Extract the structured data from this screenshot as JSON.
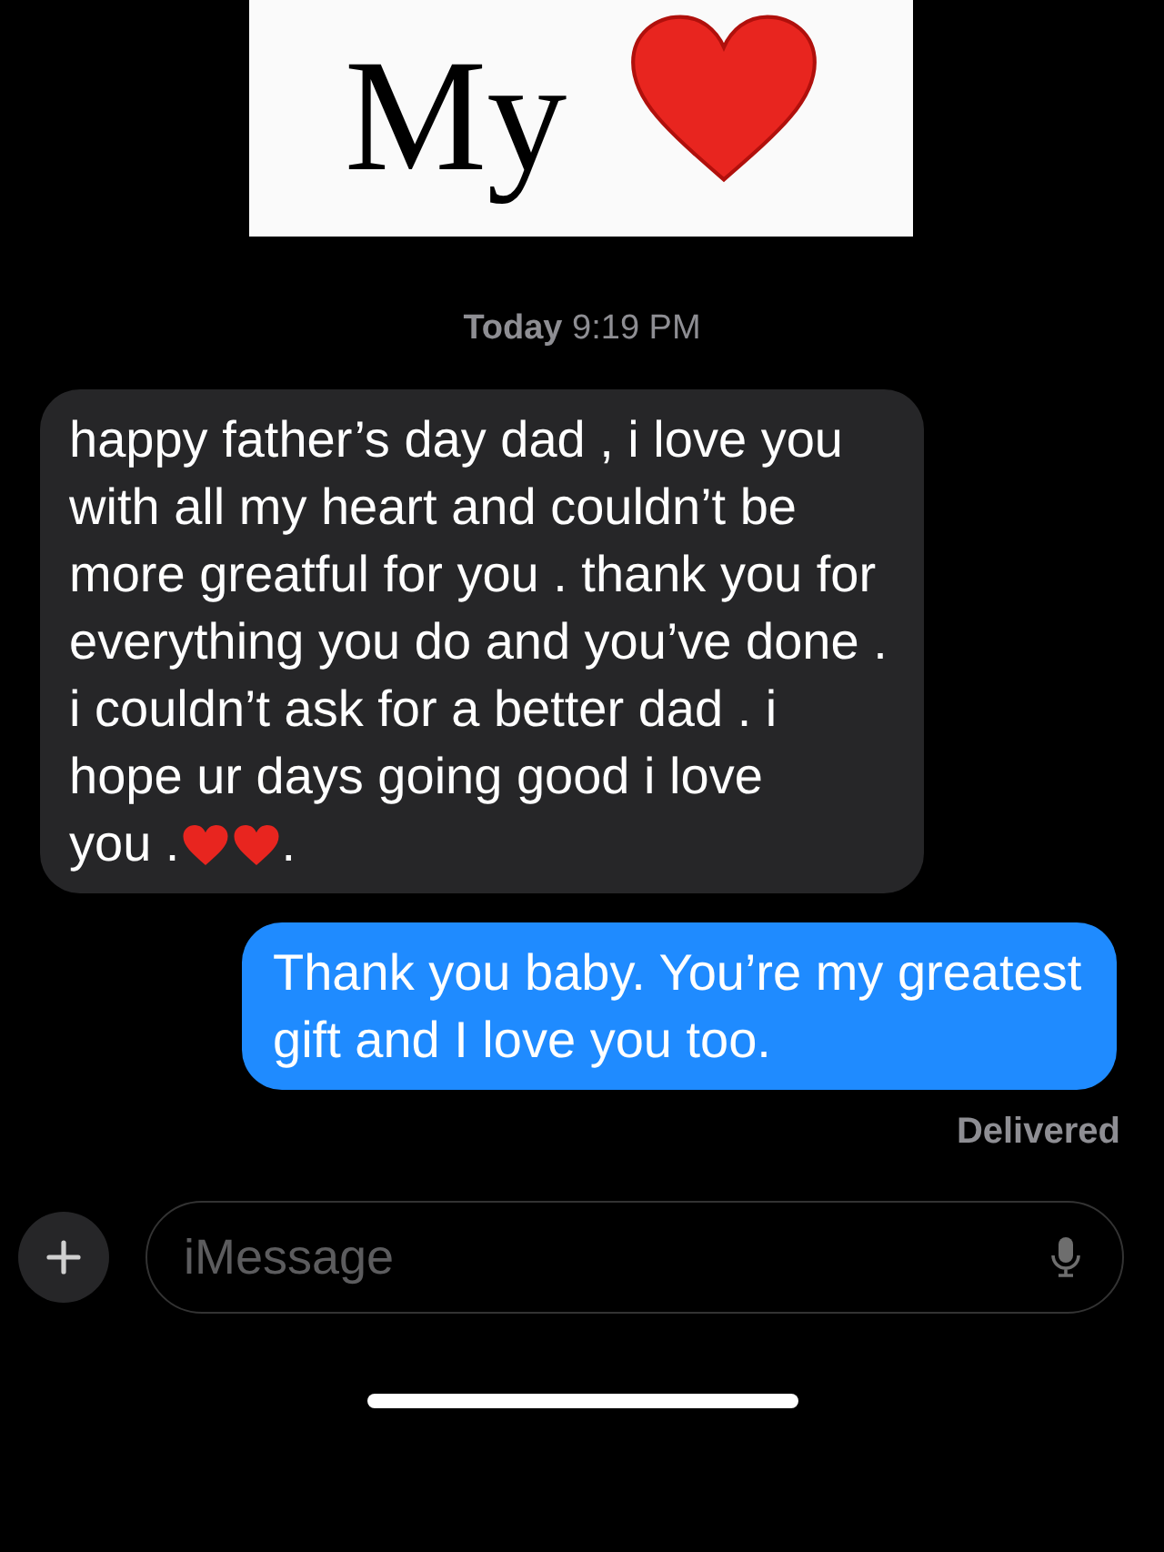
{
  "caption": {
    "text": "My"
  },
  "timestamp": "**Today** 9:19 PM",
  "messages": [
    {
      "kind": "received",
      "segments": [
        {
          "kind": "paragraph",
          "text": "happy father’s day dad , i love you with all my heart and couldn’t be more greatful for you . thank you for everything you do and you’ve done . i couldn’t ask for a better dad . i hope ur days going good i love"
        },
        {
          "kind": "text",
          "text": "you ."
        },
        {
          "kind": "heart"
        },
        {
          "kind": "heart"
        },
        {
          "kind": "text",
          "text": "."
        }
      ]
    },
    {
      "kind": "sent",
      "segments": [
        {
          "kind": "paragraph",
          "text": "Thank you baby. You’re my greatest gift and I love you too."
        }
      ]
    }
  ],
  "status": "Delivered",
  "input": {
    "placeholder": "iMessage"
  }
}
